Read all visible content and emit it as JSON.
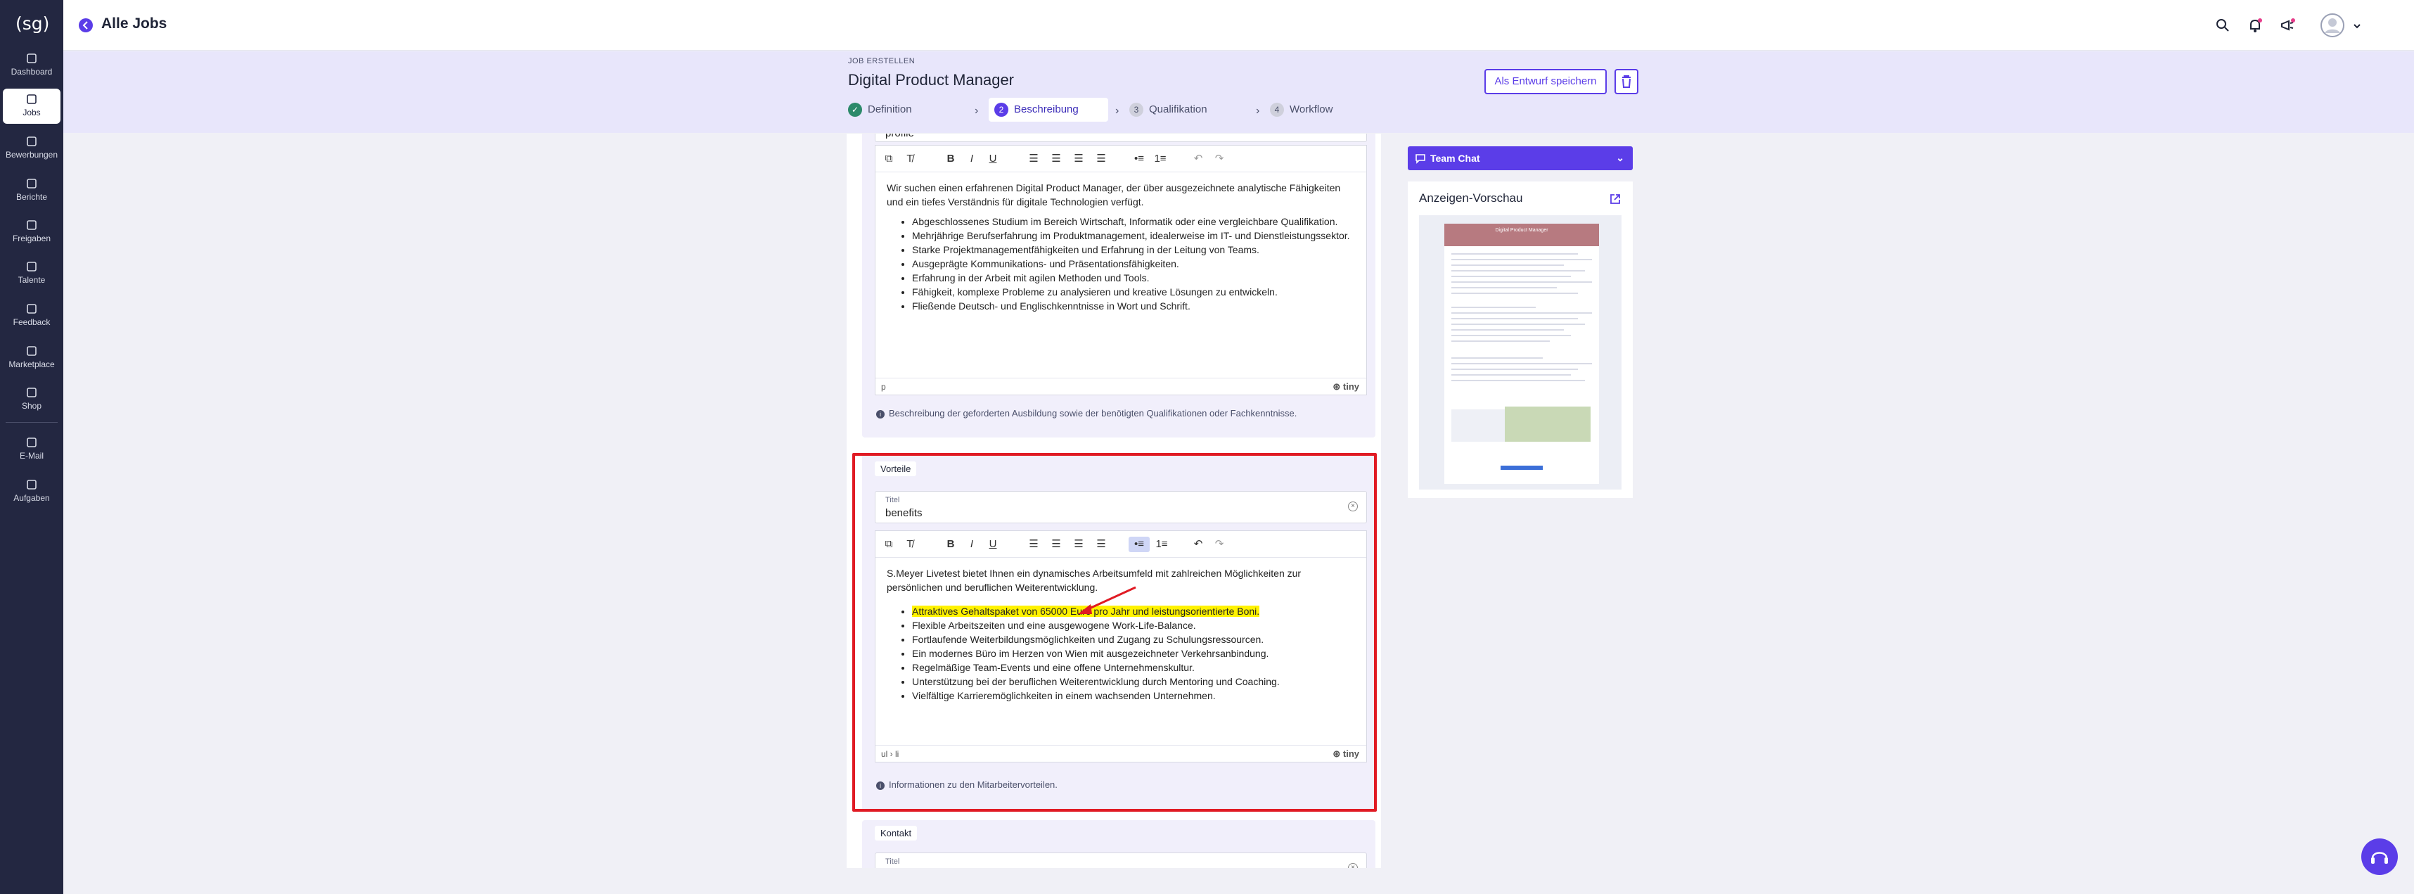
{
  "app": {
    "logo": "(sg)",
    "back_title": "Alle Jobs"
  },
  "sidebar": {
    "items": [
      {
        "label": "Dashboard",
        "icon": "dashboard-icon"
      },
      {
        "label": "Jobs",
        "icon": "briefcase-icon",
        "active": true
      },
      {
        "label": "Bewerbungen",
        "icon": "users-icon"
      },
      {
        "label": "Berichte",
        "icon": "chat-report-icon"
      },
      {
        "label": "Freigaben",
        "icon": "share-icon"
      },
      {
        "label": "Talente",
        "icon": "star-icon"
      },
      {
        "label": "Feedback",
        "icon": "feedback-icon"
      },
      {
        "label": "Marketplace",
        "icon": "marketplace-icon"
      },
      {
        "label": "Shop",
        "icon": "shop-icon"
      },
      {
        "label": "E-Mail",
        "icon": "mail-icon"
      },
      {
        "label": "Aufgaben",
        "icon": "tasks-icon"
      }
    ]
  },
  "header": {
    "section_label": "JOB ERSTELLEN",
    "job_title": "Digital Product Manager",
    "draft_button": "Als Entwurf speichern",
    "steps": [
      {
        "number": "✓",
        "label": "Definition",
        "state": "done"
      },
      {
        "number": "2",
        "label": "Beschreibung",
        "state": "current"
      },
      {
        "number": "3",
        "label": "Qualifikation",
        "state": "pending"
      },
      {
        "number": "4",
        "label": "Workflow",
        "state": "pending"
      }
    ]
  },
  "profile_section": {
    "field_value_partial": "profile",
    "intro": "Wir suchen einen erfahrenen Digital Product Manager, der über ausgezeichnete analytische Fähigkeiten und ein tiefes Verständnis für digitale Technologien verfügt.",
    "bullets": [
      "Abgeschlossenes Studium im Bereich Wirtschaft, Informatik oder eine vergleichbare Qualifikation.",
      "Mehrjährige Berufserfahrung im Produktmanagement, idealerweise im IT- und Dienstleistungssektor.",
      "Starke Projektmanagementfähigkeiten und Erfahrung in der Leitung von Teams.",
      "Ausgeprägte Kommunikations- und Präsentationsfähigkeiten.",
      "Erfahrung in der Arbeit mit agilen Methoden und Tools.",
      "Fähigkeit, komplexe Probleme zu analysieren und kreative Lösungen zu entwickeln.",
      "Fließende Deutsch- und Englischkenntnisse in Wort und Schrift."
    ],
    "status_path": "p",
    "tiny_label": "tiny",
    "hint": "Beschreibung der geforderten Ausbildung sowie der benötigten Qualifikationen oder Fachkenntnisse."
  },
  "benefits_section": {
    "title": "Vorteile",
    "field_label": "Titel",
    "field_value": "benefits",
    "intro": "S.Meyer Livetest bietet Ihnen ein dynamisches Arbeitsumfeld mit zahlreichen Möglichkeiten zur persönlichen und beruflichen Weiterentwicklung.",
    "highlighted_bullet": "Attraktives Gehaltspaket von 65000 Euro pro Jahr und leistungsorientierte Boni.",
    "bullets": [
      "Flexible Arbeitszeiten und eine ausgewogene Work-Life-Balance.",
      "Fortlaufende Weiterbildungsmöglichkeiten und Zugang zu Schulungsressourcen.",
      "Ein modernes Büro im Herzen von Wien mit ausgezeichneter Verkehrsanbindung.",
      "Regelmäßige Team-Events und eine offene Unternehmenskultur.",
      "Unterstützung bei der beruflichen Weiterentwicklung durch Mentoring und Coaching.",
      "Vielfältige Karrieremöglichkeiten in einem wachsenden Unternehmen."
    ],
    "status_path": "ul › li",
    "tiny_label": "tiny",
    "hint": "Informationen zu den Mitarbeitervorteilen."
  },
  "contact_section": {
    "title": "Kontakt",
    "field_label": "Titel"
  },
  "right_panel": {
    "chat_label": "Team Chat",
    "preview_title": "Anzeigen-Vorschau",
    "preview_banner_title": "Digital Product Manager"
  },
  "colors": {
    "accent": "#5b3de8",
    "sidebar": "#232741",
    "highlight": "#fff200",
    "frame": "#e01b24"
  }
}
